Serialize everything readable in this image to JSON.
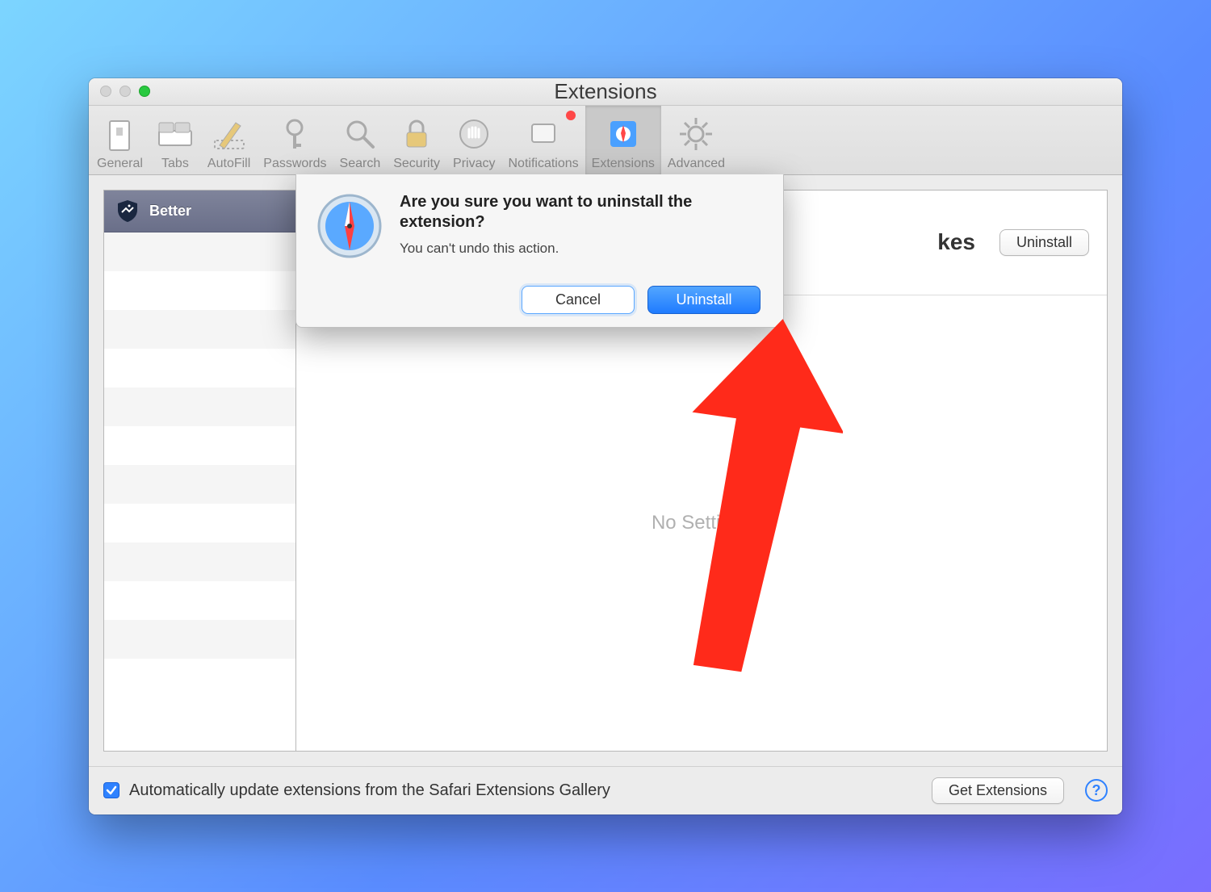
{
  "window": {
    "title": "Extensions"
  },
  "toolbar": [
    {
      "label": "General",
      "icon": "switch-icon"
    },
    {
      "label": "Tabs",
      "icon": "tabs-icon"
    },
    {
      "label": "AutoFill",
      "icon": "pencil-icon"
    },
    {
      "label": "Passwords",
      "icon": "key-icon"
    },
    {
      "label": "Search",
      "icon": "search-icon"
    },
    {
      "label": "Security",
      "icon": "lock-icon"
    },
    {
      "label": "Privacy",
      "icon": "hand-icon"
    },
    {
      "label": "Notifications",
      "icon": "bell-icon",
      "badge": true
    },
    {
      "label": "Extensions",
      "icon": "puzzle-icon",
      "active": true
    },
    {
      "label": "Advanced",
      "icon": "gear-icon"
    }
  ],
  "sidebar": {
    "items": [
      {
        "name": "Better"
      }
    ]
  },
  "main": {
    "header_fragment": "kes",
    "uninstall_label": "Uninstall",
    "no_settings_label": "No Settings"
  },
  "dialog": {
    "title": "Are you sure you want to uninstall the extension?",
    "subtitle": "You can't undo this action.",
    "cancel_label": "Cancel",
    "confirm_label": "Uninstall"
  },
  "footer": {
    "auto_update_checked": true,
    "auto_update_label": "Automatically update extensions from the Safari Extensions Gallery",
    "get_extensions_label": "Get Extensions"
  }
}
